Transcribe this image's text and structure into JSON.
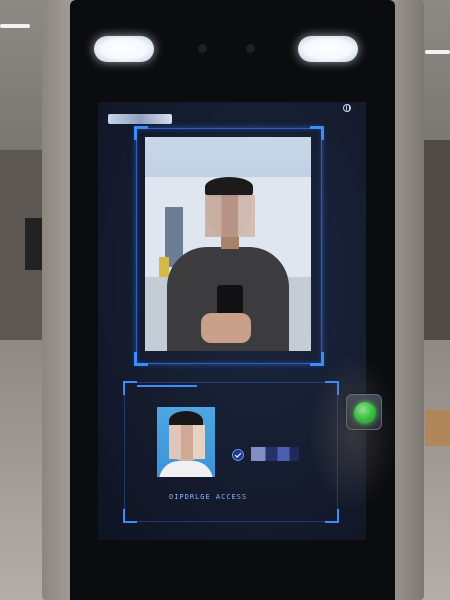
{
  "kiosk": {
    "status_color": "#2fdc3b",
    "accent_color": "#3a8cff",
    "screen_bg": "#141b2d"
  },
  "result": {
    "access_label": "OIPDRLGE ACCESS",
    "check_icon": "check-icon",
    "status_icon": "green-light-icon"
  },
  "camera": {
    "globe_icon": "globe-icon"
  }
}
